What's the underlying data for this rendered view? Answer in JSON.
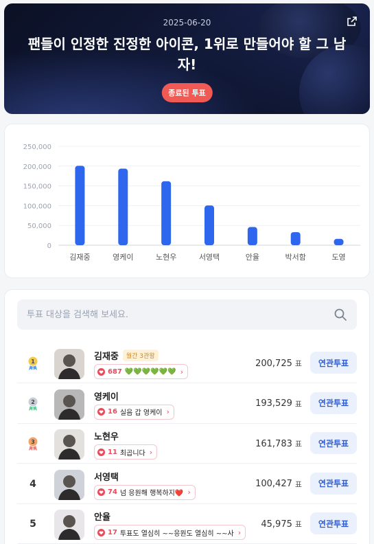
{
  "hero": {
    "date": "2025-06-20",
    "title": "팬들이 인정한 진정한 아이콘, 1위로 만들어야 할 그 남자!",
    "status_badge": "종료된 투표",
    "share_icon": "external-link-icon"
  },
  "chart_data": {
    "type": "bar",
    "categories": [
      "김재중",
      "영케이",
      "노현우",
      "서영택",
      "안율",
      "박서함",
      "도영"
    ],
    "values": [
      200725,
      193529,
      161783,
      100427,
      45975,
      33000,
      16000
    ],
    "y_ticks": [
      "250,000",
      "200,000",
      "150,000",
      "100,000",
      "50,000",
      "0"
    ],
    "ylim": [
      0,
      250000
    ],
    "bar_color": "#2f66ee",
    "grid": true
  },
  "search": {
    "placeholder": "투표 대상을 검색해 보세요.",
    "icon": "search-icon"
  },
  "unit": "표",
  "related_label": "연관투표",
  "rows": [
    {
      "rank": "1",
      "medal": "gold",
      "name": "김재중",
      "badge": "월간 3관왕",
      "cheer_count": "687",
      "cheer_text": "💚💚💚💚💚💚",
      "votes": "200,725"
    },
    {
      "rank": "2",
      "medal": "silver",
      "name": "영케이",
      "badge": "",
      "cheer_count": "16",
      "cheer_text": "실음 갑 영케이",
      "votes": "193,529"
    },
    {
      "rank": "3",
      "medal": "bronze",
      "name": "노현우",
      "badge": "",
      "cheer_count": "11",
      "cheer_text": "최곱니다",
      "votes": "161,783"
    },
    {
      "rank": "4",
      "medal": "",
      "name": "서영택",
      "badge": "",
      "cheer_count": "74",
      "cheer_text": "넘 응원해 행복하지❤️",
      "votes": "100,427"
    },
    {
      "rank": "5",
      "medal": "",
      "name": "안율",
      "badge": "",
      "cheer_count": "17",
      "cheer_text": "투표도 열심히 ~~응원도 열심히 ~~사",
      "votes": "45,975"
    }
  ],
  "colors": {
    "accent": "#2f66ee",
    "badge_red": "#f05a55",
    "button_bg": "#eaf1fd",
    "button_text": "#2f5bd0",
    "gold": "#f2c94c",
    "silver": "#c9ced6",
    "bronze": "#f0a36b"
  }
}
